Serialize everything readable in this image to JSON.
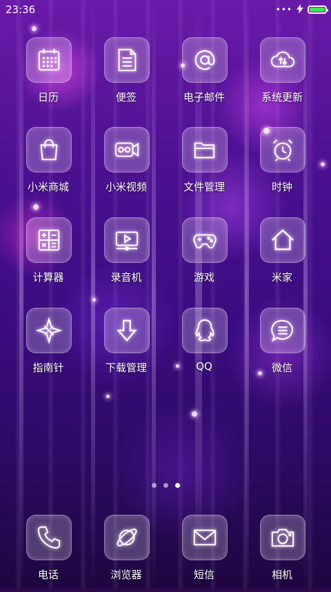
{
  "status_bar": {
    "time": "23:36",
    "dots": "•••",
    "battery_level": 1.0,
    "battery_color": "#3fe35a",
    "charging_icon": "lightning-icon"
  },
  "apps": [
    {
      "label": "日历",
      "icon": "calendar-icon"
    },
    {
      "label": "便签",
      "icon": "notes-icon"
    },
    {
      "label": "电子邮件",
      "icon": "email-at-icon"
    },
    {
      "label": "系统更新",
      "icon": "cloud-upload-icon"
    },
    {
      "label": "小米商城",
      "icon": "shopping-bag-icon"
    },
    {
      "label": "小米视频",
      "icon": "video-camera-icon"
    },
    {
      "label": "文件管理",
      "icon": "folder-icon"
    },
    {
      "label": "时钟",
      "icon": "alarm-clock-icon"
    },
    {
      "label": "计算器",
      "icon": "calculator-icon"
    },
    {
      "label": "录音机",
      "icon": "recorder-icon"
    },
    {
      "label": "游戏",
      "icon": "gamepad-icon"
    },
    {
      "label": "米家",
      "icon": "home-icon"
    },
    {
      "label": "指南针",
      "icon": "compass-icon"
    },
    {
      "label": "下载管理",
      "icon": "download-arrow-icon"
    },
    {
      "label": "QQ",
      "icon": "qq-penguin-icon"
    },
    {
      "label": "微信",
      "icon": "chat-bubble-icon"
    }
  ],
  "dock": [
    {
      "label": "电话",
      "icon": "phone-icon"
    },
    {
      "label": "浏览器",
      "icon": "browser-planet-icon"
    },
    {
      "label": "短信",
      "icon": "envelope-icon"
    },
    {
      "label": "相机",
      "icon": "camera-icon"
    }
  ],
  "page_indicator": {
    "count": 3,
    "active_index": 2
  }
}
